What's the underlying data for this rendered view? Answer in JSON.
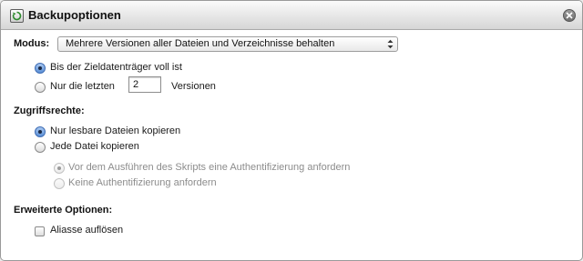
{
  "window": {
    "title": "Backupoptionen"
  },
  "modus": {
    "label": "Modus:",
    "selected": "Mehrere Versionen aller Dateien und Verzeichnisse behalten",
    "options": [
      {
        "label": "Bis der Zieldatenträger voll ist",
        "selected": true
      },
      {
        "label_before": "Nur die letzten",
        "value": "2",
        "label_after": "Versionen",
        "selected": false
      }
    ]
  },
  "zugriffsrechte": {
    "heading": "Zugriffsrechte:",
    "options": [
      {
        "label": "Nur lesbare Dateien kopieren",
        "selected": true
      },
      {
        "label": "Jede Datei kopieren",
        "selected": false
      }
    ],
    "sub_options": [
      {
        "label": "Vor dem Ausführen des Skripts eine Authentifizierung anfordern",
        "selected": true,
        "enabled": false
      },
      {
        "label": "Keine Authentifizierung anfordern",
        "selected": false,
        "enabled": false
      }
    ]
  },
  "erweitert": {
    "heading": "Erweiterte Optionen:",
    "checkbox": {
      "label": "Aliasse auflösen",
      "checked": false
    }
  }
}
